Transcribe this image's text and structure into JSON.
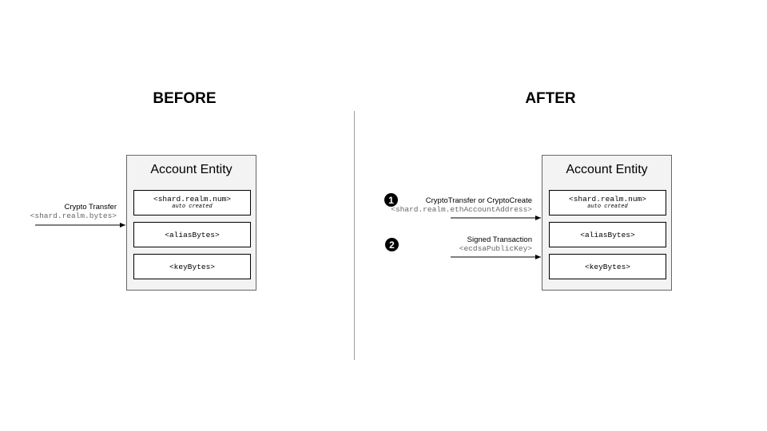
{
  "before": {
    "heading": "BEFORE",
    "entity": {
      "title": "Account Entity",
      "fields": [
        {
          "label": "<shard.realm.num>",
          "note": "auto created"
        },
        {
          "label": "<aliasBytes>"
        },
        {
          "label": "<keyBytes>"
        }
      ]
    },
    "arrow": {
      "label": "Crypto Transfer",
      "sublabel": "<shard.realm.bytes>"
    }
  },
  "after": {
    "heading": "AFTER",
    "entity": {
      "title": "Account Entity",
      "fields": [
        {
          "label": "<shard.realm.num>",
          "note": "auto created"
        },
        {
          "label": "<aliasBytes>"
        },
        {
          "label": "<keyBytes>"
        }
      ]
    },
    "steps": [
      {
        "number": "1",
        "label": "CryptoTransfer or CryptoCreate",
        "sublabel": "<shard.realm.ethAccountAddress>"
      },
      {
        "number": "2",
        "label": "Signed Transaction",
        "sublabel": "<ecdsaPublicKey>"
      }
    ]
  },
  "colors": {
    "entity_fill": "#f3f3f3",
    "divider": "#9e9e9e",
    "sublabel_text": "#666666"
  }
}
